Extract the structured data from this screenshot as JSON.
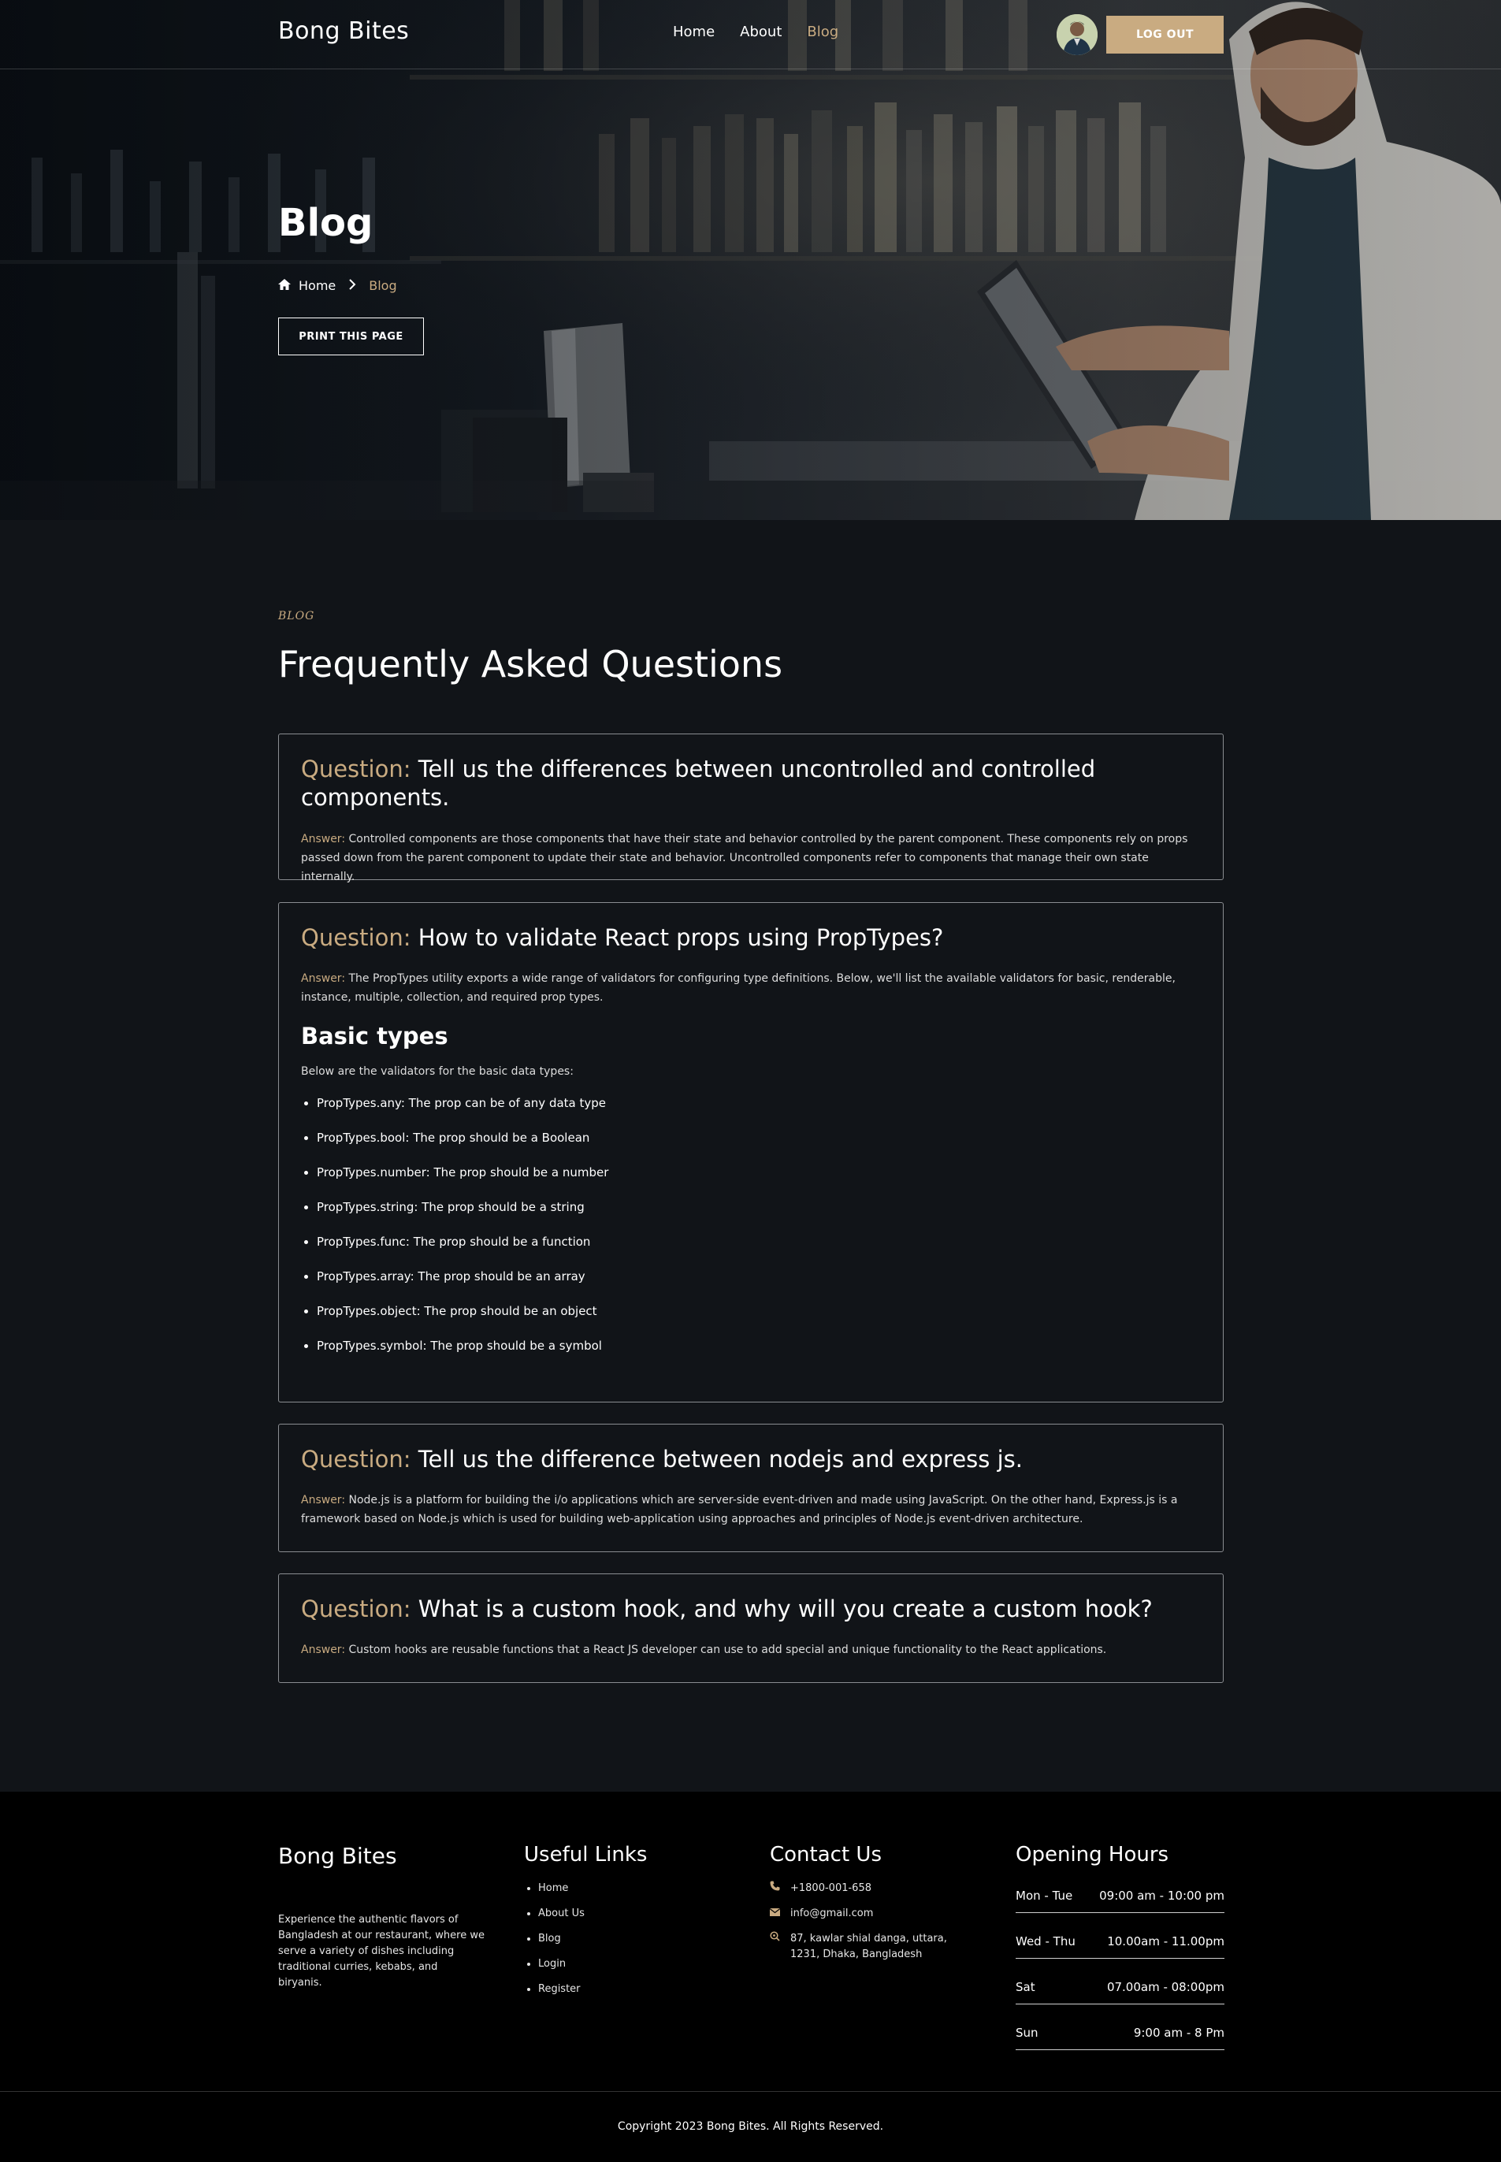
{
  "nav": {
    "brand": "Bong Bites",
    "links": [
      "Home",
      "About",
      "Blog"
    ],
    "logout": "LOG OUT"
  },
  "hero": {
    "title": "Blog",
    "breadcrumb_home": "Home",
    "breadcrumb_current": "Blog",
    "print_button": "PRINT THIS PAGE"
  },
  "faq": {
    "eyebrow": "BLOG",
    "title": "Frequently Asked Questions",
    "question_label": "Question:",
    "answer_label": "Answer:",
    "items": [
      {
        "question": "Tell us the differences between uncontrolled and controlled components.",
        "answer": "Controlled components are those components that have their state and behavior controlled by the parent component. These components rely on props passed down from the parent component to update their state and behavior. Uncontrolled components refer to components that manage their own state internally."
      },
      {
        "question": "How to validate React props using PropTypes?",
        "answer": "The PropTypes utility exports a wide range of validators for configuring type definitions. Below, we'll list the available validators for basic, renderable, instance, multiple, collection, and required prop types.",
        "subheading": "Basic types",
        "intro": "Below are the validators for the basic data types:",
        "bullets": [
          "PropTypes.any: The prop can be of any data type",
          "PropTypes.bool: The prop should be a Boolean",
          "PropTypes.number: The prop should be a number",
          "PropTypes.string: The prop should be a string",
          "PropTypes.func: The prop should be a function",
          "PropTypes.array: The prop should be an array",
          "PropTypes.object: The prop should be an object",
          "PropTypes.symbol: The prop should be a symbol"
        ]
      },
      {
        "question": "Tell us the difference between nodejs and express js.",
        "answer": "Node.js is a platform for building the i/o applications which are server-side event-driven and made using JavaScript. On the other hand, Express.js is a framework based on Node.js which is used for building web-application using approaches and principles of Node.js event-driven architecture."
      },
      {
        "question": "What is a custom hook, and why will you create a custom hook?",
        "answer": "Custom hooks are reusable functions that a React JS developer can use to add special and unique functionality to the React applications."
      }
    ]
  },
  "footer": {
    "brand": "Bong Bites",
    "about": "Experience the authentic flavors of Bangladesh at our restaurant, where we serve a variety of dishes including traditional curries, kebabs, and biryanis.",
    "links_title": "Useful Links",
    "links": [
      "Home",
      "About Us",
      "Blog",
      "Login",
      "Register"
    ],
    "contact_title": "Contact Us",
    "phone": "+1800-001-658",
    "email": "info@gmail.com",
    "address": "87, kawlar shial danga, uttara, 1231, Dhaka, Bangladesh",
    "hours_title": "Opening Hours",
    "hours": [
      {
        "day": "Mon - Tue",
        "time": "09:00 am - 10:00 pm"
      },
      {
        "day": "Wed - Thu",
        "time": "10.00am - 11.00pm"
      },
      {
        "day": "Sat",
        "time": "07.00am - 08:00pm"
      },
      {
        "day": "Sun",
        "time": "9:00 am - 8 Pm"
      }
    ],
    "copyright": "Copyright 2023 Bong Bites. All Rights Reserved."
  },
  "colors": {
    "accent": "#c9ab81",
    "background": "#111418",
    "footer": "#000000"
  },
  "icons": [
    "home-icon",
    "chevron-right-icon",
    "phone-icon",
    "mail-icon",
    "location-icon"
  ]
}
